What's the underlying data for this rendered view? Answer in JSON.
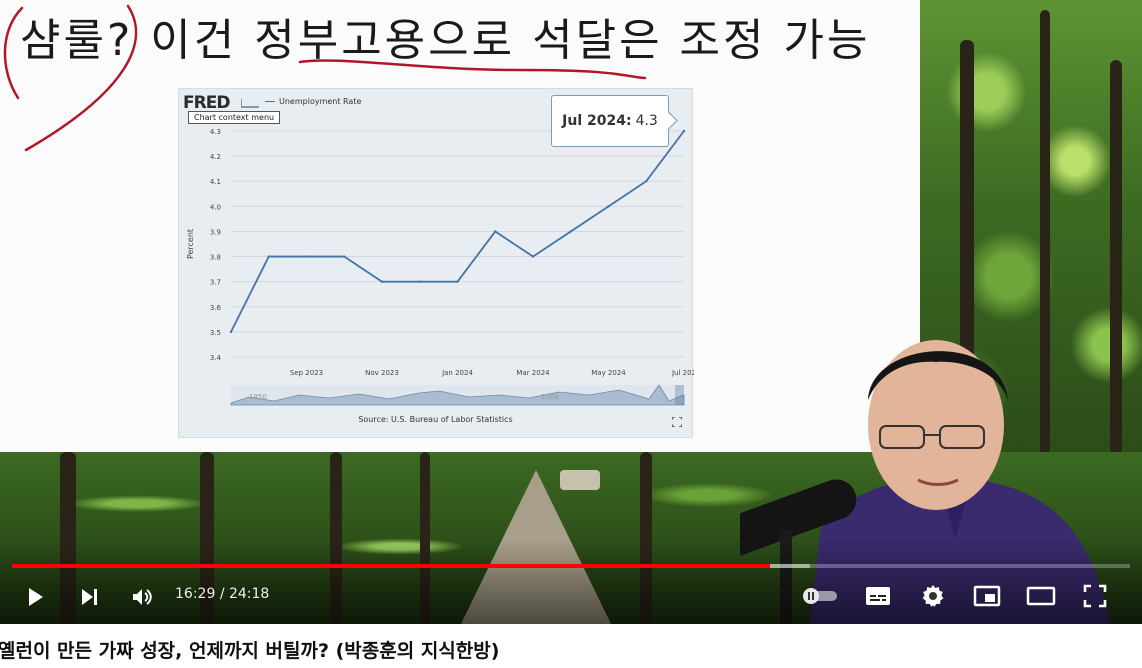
{
  "slide": {
    "heading": "샴룰? 이건 정부고용으로 석달은 조정 가능"
  },
  "fred_chart": {
    "logo": "FRED",
    "series_label": "Unemployment Rate",
    "context_menu_label": "Chart context menu",
    "tooltip_date": "Jul 2024:",
    "tooltip_value": "4.3",
    "source": "Source: U.S. Bureau of Labor Statistics",
    "fullscreen_icon": "expand-icon"
  },
  "chart_data": {
    "type": "line",
    "title": "",
    "series": [
      {
        "name": "Unemployment Rate",
        "x": [
          "Jul 2023",
          "Aug 2023",
          "Sep 2023",
          "Oct 2023",
          "Nov 2023",
          "Dec 2023",
          "Jan 2024",
          "Feb 2024",
          "Mar 2024",
          "Apr 2024",
          "May 2024",
          "Jun 2024",
          "Jul 2024"
        ],
        "values": [
          3.5,
          3.8,
          3.8,
          3.8,
          3.7,
          3.7,
          3.7,
          3.9,
          3.8,
          3.9,
          4.0,
          4.1,
          4.3
        ]
      }
    ],
    "xticks": [
      "Sep 2023",
      "Nov 2023",
      "Jan 2024",
      "Mar 2024",
      "May 2024",
      "Jul 202"
    ],
    "yticks": [
      "3.4",
      "3.5",
      "3.6",
      "3.7",
      "3.8",
      "3.9",
      "4.0",
      "4.1",
      "4.2",
      "4.3"
    ],
    "ylabel": "Percent",
    "ylim": [
      3.4,
      4.3
    ],
    "grid": true,
    "navigator_labels": [
      "1950",
      "2000"
    ],
    "colors": {
      "line": "#4572a7",
      "grid": "#cfd8e2"
    }
  },
  "player": {
    "time_current": "16:29",
    "time_total": "24:18",
    "time_separator": "/",
    "progress_played_fraction": 0.678,
    "progress_buffered_fraction": 0.714,
    "accent_color": "#ff0000",
    "buttons": {
      "play": "play-icon",
      "next": "next-icon",
      "volume": "volume-icon",
      "autoplay": "autoplay-toggle",
      "subtitles": "subtitles-icon",
      "settings": "gear-icon",
      "miniplayer": "miniplayer-icon",
      "theater": "theater-mode-icon",
      "fullscreen": "fullscreen-icon"
    }
  },
  "video": {
    "title": "옐런이 만든 가짜 성장, 언제까지 버틸까? (박종훈의 지식한방)"
  }
}
